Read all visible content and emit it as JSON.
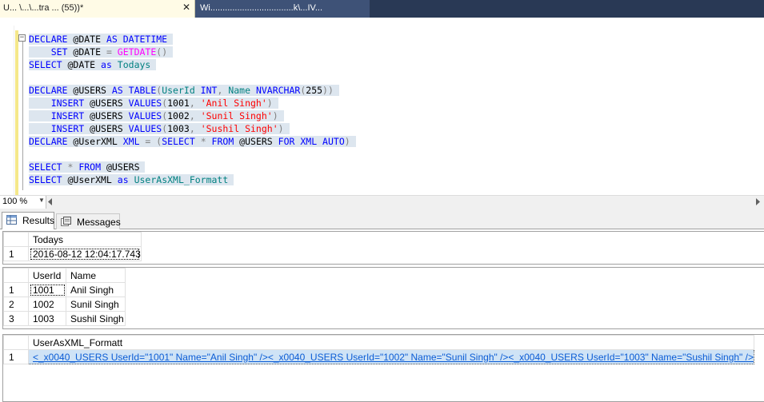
{
  "tabs": {
    "active_title": "U...                  \\...\\...tra         ...   (55))*",
    "active_close": "✕",
    "second_title": "Wi..................................k\\...IV..."
  },
  "editor": {
    "collapse_symbol": "−",
    "lines": [
      [
        {
          "t": "DECLARE",
          "c": "kw"
        },
        {
          "t": " @DATE ",
          "c": "id"
        },
        {
          "t": "AS",
          "c": "kw"
        },
        {
          "t": " DATETIME",
          "c": "kw"
        }
      ],
      [
        {
          "t": "    SET",
          "c": "kw"
        },
        {
          "t": " @DATE ",
          "c": "id"
        },
        {
          "t": "=",
          "c": "op"
        },
        {
          "t": " GETDATE",
          "c": "fn"
        },
        {
          "t": "()",
          "c": "op"
        }
      ],
      [
        {
          "t": "SELECT",
          "c": "kw"
        },
        {
          "t": " @DATE ",
          "c": "id"
        },
        {
          "t": "as",
          "c": "kw"
        },
        {
          "t": " Todays",
          "c": "alias"
        }
      ],
      [],
      [
        {
          "t": "DECLARE",
          "c": "kw"
        },
        {
          "t": " @USERS ",
          "c": "id"
        },
        {
          "t": "AS",
          "c": "kw"
        },
        {
          "t": " TABLE",
          "c": "kw"
        },
        {
          "t": "(",
          "c": "op"
        },
        {
          "t": "UserId ",
          "c": "alias"
        },
        {
          "t": "INT",
          "c": "kw"
        },
        {
          "t": ",",
          "c": "op"
        },
        {
          "t": " Name ",
          "c": "alias"
        },
        {
          "t": "NVARCHAR",
          "c": "kw"
        },
        {
          "t": "(",
          "c": "op"
        },
        {
          "t": "255",
          "c": "id"
        },
        {
          "t": "))",
          "c": "op"
        }
      ],
      [
        {
          "t": "    INSERT",
          "c": "kw"
        },
        {
          "t": " @USERS ",
          "c": "id"
        },
        {
          "t": "VALUES",
          "c": "kw"
        },
        {
          "t": "(",
          "c": "op"
        },
        {
          "t": "1001",
          "c": "id"
        },
        {
          "t": ",",
          "c": "op"
        },
        {
          "t": " 'Anil Singh'",
          "c": "str"
        },
        {
          "t": ")",
          "c": "op"
        }
      ],
      [
        {
          "t": "    INSERT",
          "c": "kw"
        },
        {
          "t": " @USERS ",
          "c": "id"
        },
        {
          "t": "VALUES",
          "c": "kw"
        },
        {
          "t": "(",
          "c": "op"
        },
        {
          "t": "1002",
          "c": "id"
        },
        {
          "t": ",",
          "c": "op"
        },
        {
          "t": " 'Sunil Singh'",
          "c": "str"
        },
        {
          "t": ")",
          "c": "op"
        }
      ],
      [
        {
          "t": "    INSERT",
          "c": "kw"
        },
        {
          "t": " @USERS ",
          "c": "id"
        },
        {
          "t": "VALUES",
          "c": "kw"
        },
        {
          "t": "(",
          "c": "op"
        },
        {
          "t": "1003",
          "c": "id"
        },
        {
          "t": ",",
          "c": "op"
        },
        {
          "t": " 'Sushil Singh'",
          "c": "str"
        },
        {
          "t": ")",
          "c": "op"
        }
      ],
      [
        {
          "t": "DECLARE",
          "c": "kw"
        },
        {
          "t": " @UserXML ",
          "c": "id"
        },
        {
          "t": "XML",
          "c": "kw"
        },
        {
          "t": " =",
          "c": "op"
        },
        {
          "t": " (",
          "c": "op"
        },
        {
          "t": "SELECT",
          "c": "kw"
        },
        {
          "t": " *",
          "c": "op"
        },
        {
          "t": " FROM",
          "c": "kw"
        },
        {
          "t": " @USERS ",
          "c": "id"
        },
        {
          "t": "FOR",
          "c": "kw"
        },
        {
          "t": " XML",
          "c": "kw"
        },
        {
          "t": " AUTO",
          "c": "kw"
        },
        {
          "t": ")",
          "c": "op"
        }
      ],
      [],
      [
        {
          "t": "SELECT",
          "c": "kw"
        },
        {
          "t": " *",
          "c": "op"
        },
        {
          "t": " FROM",
          "c": "kw"
        },
        {
          "t": " @USERS",
          "c": "id"
        }
      ],
      [
        {
          "t": "SELECT",
          "c": "kw"
        },
        {
          "t": " @UserXML ",
          "c": "id"
        },
        {
          "t": "as",
          "c": "kw"
        },
        {
          "t": " UserAsXML_Formatt",
          "c": "alias"
        }
      ]
    ]
  },
  "zoom": {
    "value": "100 %",
    "arrow": "▼"
  },
  "result_tabs": {
    "results_label": "Results",
    "messages_label": "Messages"
  },
  "grids": {
    "todays": {
      "headers": [
        "Todays"
      ],
      "rows": [
        [
          "1",
          "2016-08-12 12:04:17.743"
        ]
      ]
    },
    "users": {
      "headers": [
        "UserId",
        "Name"
      ],
      "rows": [
        [
          "1",
          "1001",
          "Anil Singh"
        ],
        [
          "2",
          "1002",
          "Sunil Singh"
        ],
        [
          "3",
          "1003",
          "Sushil Singh"
        ]
      ]
    },
    "xml": {
      "headers": [
        "UserAsXML_Formatt"
      ],
      "rows": [
        [
          "1",
          "<_x0040_USERS UserId=\"1001\" Name=\"Anil Singh\" /><_x0040_USERS UserId=\"1002\" Name=\"Sunil Singh\" /><_x0040_USERS UserId=\"1003\" Name=\"Sushil Singh\" />"
        ]
      ]
    }
  },
  "colors": {
    "keyword": "#0000ff",
    "function": "#ff00ff",
    "string": "#ff0000",
    "alias": "#008080",
    "tab_strip": "#293955",
    "active_tab": "#fffbe6",
    "xml_link": "#0b5cd5",
    "selection": "#cfe3f6"
  }
}
